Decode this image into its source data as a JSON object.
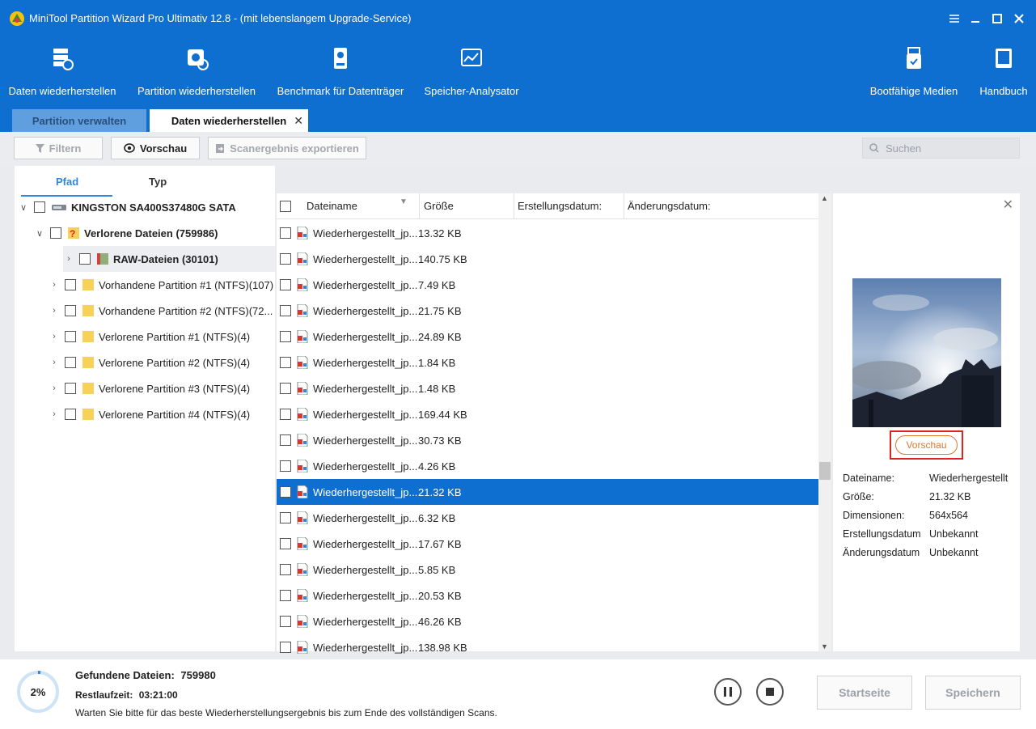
{
  "window": {
    "title": "MiniTool Partition Wizard Pro Ultimativ 12.8 - (mit lebenslangem Upgrade-Service)"
  },
  "toolbar": {
    "items": [
      {
        "label": "Daten wiederherstellen",
        "icon": "data-recovery-icon"
      },
      {
        "label": "Partition wiederherstellen",
        "icon": "partition-recovery-icon"
      },
      {
        "label": "Benchmark für Datenträger",
        "icon": "disk-benchmark-icon"
      },
      {
        "label": "Speicher-Analysator",
        "icon": "space-analyzer-icon"
      },
      {
        "label": "Bootfähige Medien",
        "icon": "bootable-media-icon"
      },
      {
        "label": "Handbuch",
        "icon": "manual-book-icon"
      }
    ]
  },
  "tabs": [
    {
      "label": "Partition verwalten",
      "active": false
    },
    {
      "label": "Daten wiederherstellen",
      "active": true
    }
  ],
  "actions": {
    "filter": "Filtern",
    "preview": "Vorschau",
    "export": "Scanergebnis exportieren",
    "search_placeholder": "Suchen"
  },
  "left_tabs": {
    "path": "Pfad",
    "type": "Typ"
  },
  "tree": [
    {
      "label": "KINGSTON SA400S37480G SATA",
      "level": 0,
      "bold": true,
      "icon": "drive-icon"
    },
    {
      "label": "Verlorene Dateien (759986)",
      "level": 1,
      "bold": true,
      "icon": "lost-files-icon"
    },
    {
      "label": "RAW-Dateien (30101)",
      "level": 2,
      "bold": true,
      "icon": "raw-files-icon",
      "selected": true
    },
    {
      "label": "Vorhandene Partition #1 (NTFS)(107)",
      "level": 2,
      "bold": false,
      "icon": "folder-icon"
    },
    {
      "label": "Vorhandene Partition #2 (NTFS)(72...",
      "level": 2,
      "bold": false,
      "icon": "folder-icon"
    },
    {
      "label": "Verlorene Partition #1 (NTFS)(4)",
      "level": 2,
      "bold": false,
      "icon": "folder-icon"
    },
    {
      "label": "Verlorene Partition #2 (NTFS)(4)",
      "level": 2,
      "bold": false,
      "icon": "folder-icon"
    },
    {
      "label": "Verlorene Partition #3 (NTFS)(4)",
      "level": 2,
      "bold": false,
      "icon": "folder-icon"
    },
    {
      "label": "Verlorene Partition #4 (NTFS)(4)",
      "level": 2,
      "bold": false,
      "icon": "folder-icon"
    }
  ],
  "file_columns": {
    "name": "Dateiname",
    "size": "Größe",
    "created": "Erstellungsdatum:",
    "modified": "Änderungsdatum:"
  },
  "files": [
    {
      "name": "Wiederhergestellt_jp...",
      "size": "13.32 KB"
    },
    {
      "name": "Wiederhergestellt_jp...",
      "size": "140.75 KB"
    },
    {
      "name": "Wiederhergestellt_jp...",
      "size": "7.49 KB"
    },
    {
      "name": "Wiederhergestellt_jp...",
      "size": "21.75 KB"
    },
    {
      "name": "Wiederhergestellt_jp...",
      "size": "24.89 KB"
    },
    {
      "name": "Wiederhergestellt_jp...",
      "size": "1.84 KB"
    },
    {
      "name": "Wiederhergestellt_jp...",
      "size": "1.48 KB"
    },
    {
      "name": "Wiederhergestellt_jp...",
      "size": "169.44 KB"
    },
    {
      "name": "Wiederhergestellt_jp...",
      "size": "30.73 KB"
    },
    {
      "name": "Wiederhergestellt_jp...",
      "size": "4.26 KB"
    },
    {
      "name": "Wiederhergestellt_jp...",
      "size": "21.32 KB",
      "selected": true
    },
    {
      "name": "Wiederhergestellt_jp...",
      "size": "6.32 KB"
    },
    {
      "name": "Wiederhergestellt_jp...",
      "size": "17.67 KB"
    },
    {
      "name": "Wiederhergestellt_jp...",
      "size": "5.85 KB"
    },
    {
      "name": "Wiederhergestellt_jp...",
      "size": "20.53 KB"
    },
    {
      "name": "Wiederhergestellt_jp...",
      "size": "46.26 KB"
    },
    {
      "name": "Wiederhergestellt_jp...",
      "size": "138.98 KB"
    }
  ],
  "preview": {
    "button": "Vorschau",
    "props": [
      {
        "key": "Dateiname:",
        "value": "Wiederhergestellt"
      },
      {
        "key": "Größe:",
        "value": "21.32 KB"
      },
      {
        "key": "Dimensionen:",
        "value": "564x564"
      },
      {
        "key": "Erstellungsdatum",
        "value": "Unbekannt"
      },
      {
        "key": "Änderungsdatum",
        "value": "Unbekannt"
      }
    ]
  },
  "status": {
    "progress_percent": 2,
    "progress_label": "2%",
    "found_label": "Gefundene Dateien:",
    "found_value": "759980",
    "remaining_label": "Restlaufzeit:",
    "remaining_value": "03:21:00",
    "hint": "Warten Sie bitte für das beste Wiederherstellungsergebnis bis zum Ende des vollständigen Scans.",
    "home_button": "Startseite",
    "save_button": "Speichern"
  },
  "colors": {
    "header_blue": "#0f6fd0",
    "selection_blue": "#0f6fd0",
    "highlight_red": "#e2231a",
    "preview_orange": "#e0782e"
  }
}
